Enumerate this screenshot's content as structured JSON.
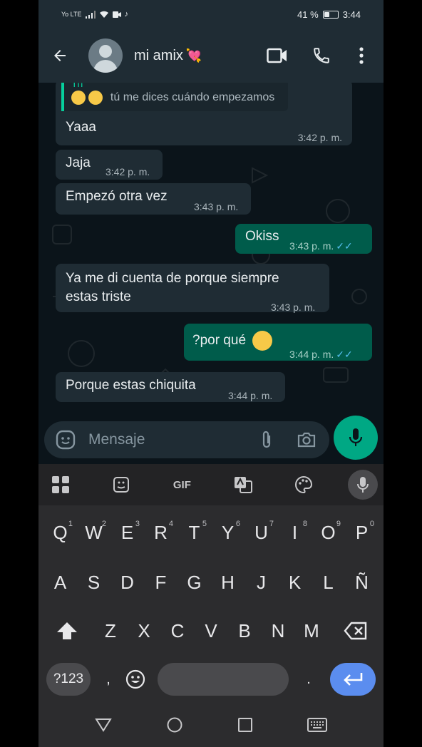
{
  "status_bar": {
    "left_indicators": "Yo LTE",
    "battery": "41 %",
    "battery_level": 0.41,
    "time": "3:44"
  },
  "header": {
    "contact_name": "mi amix",
    "contact_emoji": "💘",
    "icons": [
      "back-arrow-icon",
      "video-call-icon",
      "phone-icon",
      "more-options-icon"
    ]
  },
  "chat": {
    "quote": {
      "author": "Tú",
      "text": "tú me dices cuándo empezamos"
    },
    "messages": [
      {
        "dir": "in",
        "text": "Yaaa",
        "time": "3:42 p. m."
      },
      {
        "dir": "in",
        "text": "Jaja",
        "time": "3:42 p. m."
      },
      {
        "dir": "in",
        "text": "Empezó otra vez",
        "time": "3:43 p. m."
      },
      {
        "dir": "out",
        "text": "Okiss",
        "time": "3:43 p. m.",
        "ticks": "✓✓"
      },
      {
        "dir": "in",
        "text_line1": "Ya me di cuenta de porque siempre",
        "text_line2": "estas triste",
        "time": "3:43 p. m."
      },
      {
        "dir": "out",
        "text": "?por qué",
        "time": "3:44 p. m.",
        "ticks": "✓✓"
      },
      {
        "dir": "in",
        "text": "Porque estas chiquita",
        "time": "3:44 p. m."
      }
    ]
  },
  "composer": {
    "placeholder": "Mensaje"
  },
  "keyboard": {
    "toolbar": {
      "gif_label": "GIF"
    },
    "row1": [
      {
        "k": "Q",
        "n": "1"
      },
      {
        "k": "W",
        "n": "2"
      },
      {
        "k": "E",
        "n": "3"
      },
      {
        "k": "R",
        "n": "4"
      },
      {
        "k": "T",
        "n": "5"
      },
      {
        "k": "Y",
        "n": "6"
      },
      {
        "k": "U",
        "n": "7"
      },
      {
        "k": "I",
        "n": "8"
      },
      {
        "k": "O",
        "n": "9"
      },
      {
        "k": "P",
        "n": "0"
      }
    ],
    "row2": [
      "A",
      "S",
      "D",
      "F",
      "G",
      "H",
      "J",
      "K",
      "L",
      "Ñ"
    ],
    "row3": [
      "Z",
      "X",
      "C",
      "V",
      "B",
      "N",
      "M"
    ],
    "symbols_key": "?123",
    "comma": ",",
    "period": "."
  },
  "colors": {
    "bubble_in": "#1f2c34",
    "bubble_out": "#005c4b",
    "accent": "#00a884",
    "read_ticks": "#53bdeb",
    "enter_key": "#5b8def"
  }
}
